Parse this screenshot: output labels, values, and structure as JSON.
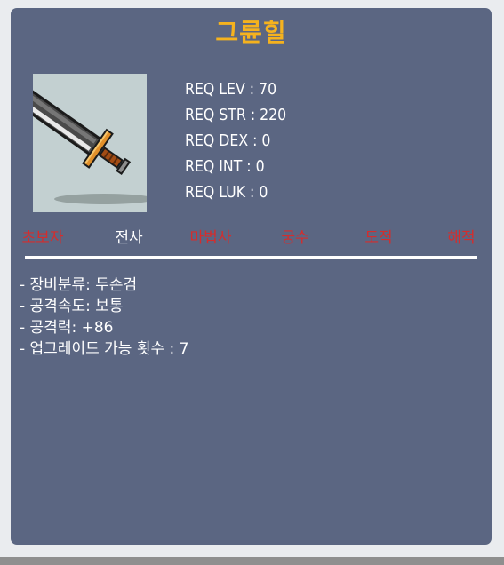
{
  "item": {
    "name": "그륜힐",
    "icon": "two-handed-sword-icon"
  },
  "requirements": [
    {
      "label": "REQ LEV : 70"
    },
    {
      "label": "REQ STR : 220"
    },
    {
      "label": "REQ DEX : 0"
    },
    {
      "label": "REQ INT : 0"
    },
    {
      "label": "REQ LUK : 0"
    }
  ],
  "jobs": [
    {
      "label": "초보자",
      "allowed": false
    },
    {
      "label": "전사",
      "allowed": true
    },
    {
      "label": "마법사",
      "allowed": false
    },
    {
      "label": "궁수",
      "allowed": false
    },
    {
      "label": "도적",
      "allowed": false
    },
    {
      "label": "해적",
      "allowed": false
    }
  ],
  "stats": [
    {
      "label": "- 장비분류: 두손검"
    },
    {
      "label": "- 공격속도: 보통"
    },
    {
      "label": "- 공격력: +86"
    },
    {
      "label": "- 업그레이드 가능 횟수 : 7"
    }
  ],
  "colors": {
    "card_background": "#5b6682",
    "title": "#f5b21e",
    "job_allowed": "#ffffff",
    "job_disallowed": "#d42d2d"
  }
}
